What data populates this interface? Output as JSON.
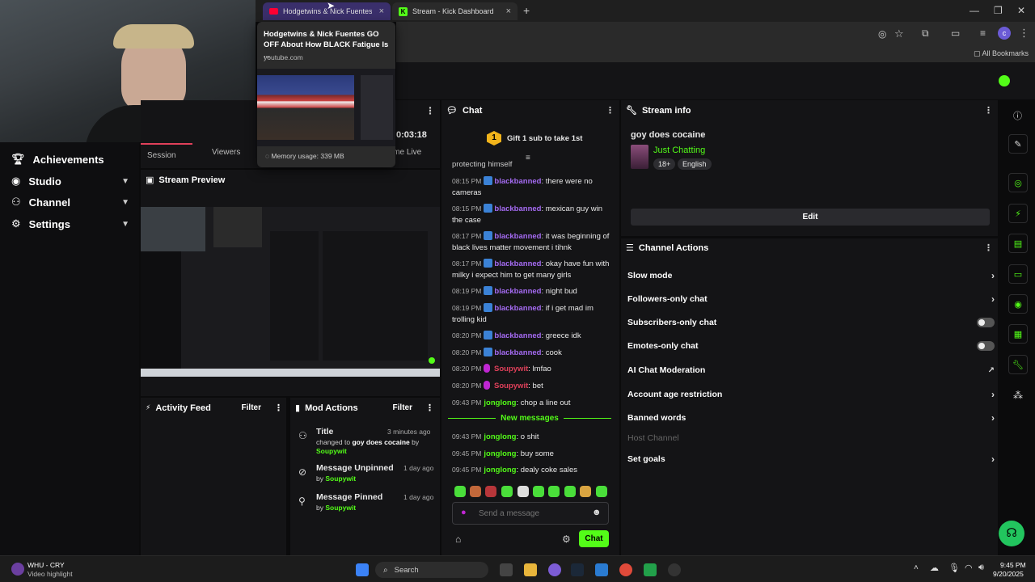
{
  "browser": {
    "tabs": [
      {
        "title": "Hodgetwins & Nick Fuentes GO"
      },
      {
        "title": "Stream - Kick Dashboard"
      }
    ],
    "bookmarks_label": "All Bookmarks"
  },
  "tab_preview": {
    "title": "Hodgetwins & Nick Fuentes GO OFF About How BLACK Fatigue Is ...",
    "domain": "youtube.com",
    "memory": "Memory usage: 339 MB"
  },
  "sidebar": {
    "items": [
      {
        "label": "Achievements",
        "icon": "trophy-icon",
        "expand": false
      },
      {
        "label": "Studio",
        "icon": "studio-icon",
        "expand": true
      },
      {
        "label": "Channel",
        "icon": "channel-icon",
        "expand": true
      },
      {
        "label": "Settings",
        "icon": "gear-icon",
        "expand": true
      }
    ]
  },
  "session": {
    "tabs": [
      "Session",
      "Viewers",
      "ime Live"
    ],
    "time": "0:03:18"
  },
  "stream_preview": {
    "title": "Stream Preview"
  },
  "activity_feed": {
    "title": "Activity Feed",
    "filter": "Filter"
  },
  "mod_actions": {
    "title": "Mod Actions",
    "filter": "Filter",
    "entries": [
      {
        "title": "Title",
        "time": "3 minutes ago",
        "prefix": "changed to ",
        "value": "goy does cocaine",
        "by": " by ",
        "user": "Soupywit"
      },
      {
        "title": "Message Unpinned",
        "time": "1 day ago",
        "by": "by ",
        "user": "Soupywit"
      },
      {
        "title": "Message Pinned",
        "time": "1 day ago",
        "by": "by ",
        "user": "Soupywit"
      }
    ]
  },
  "chat": {
    "title": "Chat",
    "gift_badge": "1",
    "gift_text": "Gift 1 sub to take 1st",
    "partial_top": "protecting himself",
    "messages": [
      {
        "time": "08:15 PM",
        "user": "blackbanned",
        "text": ": there were no cameras",
        "style": "blue"
      },
      {
        "time": "08:15 PM",
        "user": "blackbanned",
        "text": ": mexican guy win the case",
        "style": "blue"
      },
      {
        "time": "08:17 PM",
        "user": "blackbanned",
        "text": ": it was beginning of black lives matter movement i tihnk",
        "style": "blue"
      },
      {
        "time": "08:17 PM",
        "user": "blackbanned",
        "text": ": okay have fun with milky i expect him to get many girls",
        "style": "blue"
      },
      {
        "time": "08:19 PM",
        "user": "blackbanned",
        "text": ": night bud",
        "style": "blue"
      },
      {
        "time": "08:19 PM",
        "user": "blackbanned",
        "text": ": if i get mad im trolling kid",
        "style": "blue"
      },
      {
        "time": "08:20 PM",
        "user": "blackbanned",
        "text": ": greece idk",
        "style": "blue"
      },
      {
        "time": "08:20 PM",
        "user": "blackbanned",
        "text": ": cook",
        "style": "blue"
      },
      {
        "time": "08:20 PM",
        "user": "Soupywit",
        "text": ": lmfao",
        "style": "red"
      },
      {
        "time": "08:20 PM",
        "user": "Soupywit",
        "text": ": bet",
        "style": "red"
      },
      {
        "time": "09:43 PM",
        "user": "jonglong",
        "text": ": chop a line out",
        "style": "green"
      }
    ],
    "new_messages": "New messages",
    "new": [
      {
        "time": "09:43 PM",
        "user": "jonglong",
        "text": ": o shit"
      },
      {
        "time": "09:45 PM",
        "user": "jonglong",
        "text": ": buy some"
      },
      {
        "time": "09:45 PM",
        "user": "jonglong",
        "text": ": dealy coke sales"
      }
    ],
    "input_placeholder": "Send a message",
    "send_label": "Chat"
  },
  "stream_info": {
    "title": "Stream info",
    "stream_title": "goy does cocaine",
    "category": "Just Chatting",
    "tags": [
      "18+",
      "English"
    ],
    "edit_label": "Edit"
  },
  "channel_actions": {
    "title": "Channel Actions",
    "items": [
      {
        "label": "Slow mode",
        "control": "arrow",
        "disabled": false
      },
      {
        "label": "Followers-only chat",
        "control": "arrow",
        "disabled": false
      },
      {
        "label": "Subscribers-only chat",
        "control": "toggle",
        "disabled": false
      },
      {
        "label": "Emotes-only chat",
        "control": "toggle",
        "disabled": false
      },
      {
        "label": "AI Chat Moderation",
        "control": "external",
        "disabled": false
      },
      {
        "label": "Account age restriction",
        "control": "arrow",
        "disabled": false
      },
      {
        "label": "Banned words",
        "control": "arrow",
        "disabled": false
      },
      {
        "label": "Host Channel",
        "control": "none",
        "disabled": true
      },
      {
        "label": "Set goals",
        "control": "arrow",
        "disabled": false
      }
    ]
  },
  "taskbar": {
    "media_title": "WHU - CRY",
    "media_sub": "Video highlight",
    "search": "Search",
    "time": "9:45 PM",
    "date": "9/20/2025"
  },
  "colors": {
    "accent": "#53fc18",
    "tab_active": "#3a2f6b"
  }
}
